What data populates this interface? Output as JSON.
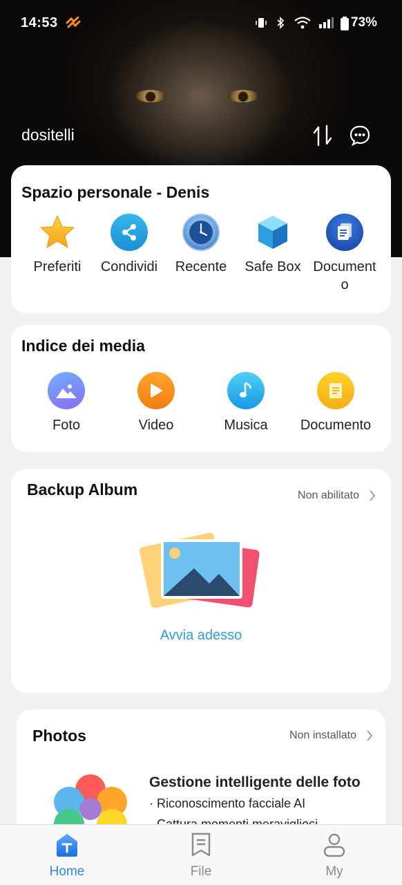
{
  "status_bar": {
    "time": "14:53",
    "battery": "73%"
  },
  "header": {
    "username": "dositelli"
  },
  "personal_space": {
    "title": "Spazio personale - Denis",
    "items": [
      {
        "label": "Preferiti",
        "icon": "star-icon"
      },
      {
        "label": "Condividi",
        "icon": "share-icon"
      },
      {
        "label": "Recente",
        "icon": "clock-icon"
      },
      {
        "label": "Safe Box",
        "icon": "safe-box-icon"
      },
      {
        "label": "Document o",
        "icon": "document-icon"
      }
    ]
  },
  "media_index": {
    "title": "Indice dei media",
    "items": [
      {
        "label": "Foto",
        "icon": "photo-icon"
      },
      {
        "label": "Video",
        "icon": "video-icon"
      },
      {
        "label": "Musica",
        "icon": "music-icon"
      },
      {
        "label": "Documento",
        "icon": "documento-icon"
      }
    ]
  },
  "backup_album": {
    "title": "Backup Album",
    "status": "Non abilitato",
    "action": "Avvia adesso"
  },
  "photos": {
    "title": "Photos",
    "status": "Non installato",
    "headline": "Gestione intelligente delle foto",
    "bullets": [
      "· Riconoscimento facciale AI",
      "· Cattura momenti meravigliosi"
    ]
  },
  "bottom_nav": [
    {
      "label": "Home",
      "active": true
    },
    {
      "label": "File",
      "active": false
    },
    {
      "label": "My",
      "active": false
    }
  ],
  "colors": {
    "accent": "#2b8be6",
    "link": "#2f9ae6",
    "inactive": "#8a8a8a"
  }
}
